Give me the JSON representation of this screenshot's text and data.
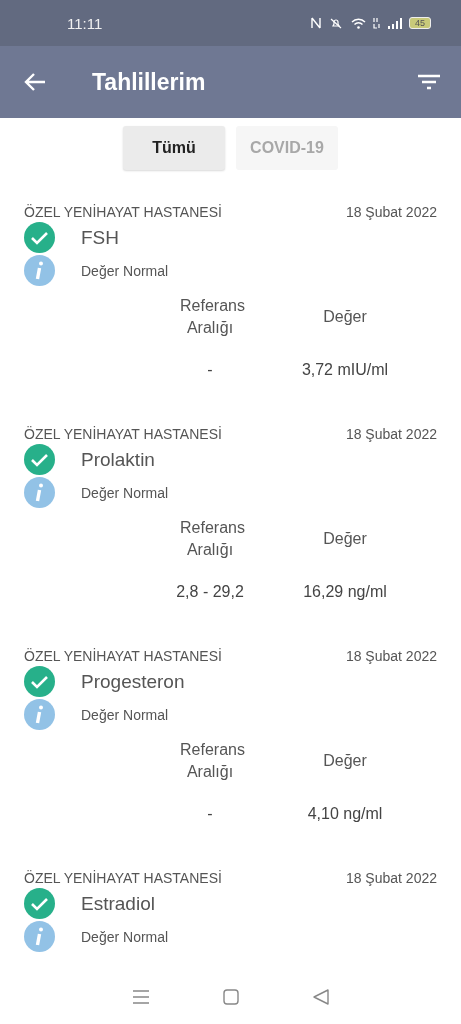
{
  "status_bar": {
    "time": "11:11",
    "battery": "45"
  },
  "app_bar": {
    "title": "Tahlillerim"
  },
  "tabs": [
    {
      "label": "Tümü",
      "selected": true
    },
    {
      "label": "COVID-19",
      "selected": false
    }
  ],
  "results": [
    {
      "hospital": "ÖZEL YENİHAYAT HASTANESİ",
      "date": "18 Şubat 2022",
      "test": "FSH",
      "status": "Değer Normal",
      "columns": [
        "Referans Aralığı",
        "Değer"
      ],
      "reference": "-",
      "value": "3,72 mIU/ml"
    },
    {
      "hospital": "ÖZEL YENİHAYAT HASTANESİ",
      "date": "18 Şubat 2022",
      "test": "Prolaktin",
      "status": "Değer Normal",
      "columns": [
        "Referans Aralığı",
        "Değer"
      ],
      "reference": "2,8 - 29,2",
      "value": "16,29 ng/ml"
    },
    {
      "hospital": "ÖZEL YENİHAYAT HASTANESİ",
      "date": "18 Şubat 2022",
      "test": "Progesteron",
      "status": "Değer Normal",
      "columns": [
        "Referans Aralığı",
        "Değer"
      ],
      "reference": "-",
      "value": "4,10 ng/ml"
    },
    {
      "hospital": "ÖZEL YENİHAYAT HASTANESİ",
      "date": "18 Şubat 2022",
      "test": "Estradiol",
      "status": "Değer Normal"
    }
  ]
}
